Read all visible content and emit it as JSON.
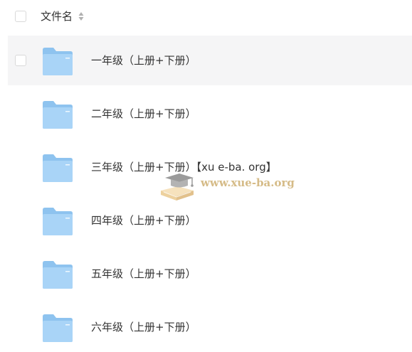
{
  "header": {
    "column_label": "文件名"
  },
  "files": [
    {
      "name": "一年级（上册+下册）",
      "type": "folder",
      "hovered": true
    },
    {
      "name": "二年级（上册+下册）",
      "type": "folder",
      "hovered": false
    },
    {
      "name": "三年级（上册+下册）【xu e-ba. org】",
      "type": "folder",
      "hovered": false
    },
    {
      "name": "四年级（上册+下册）",
      "type": "folder",
      "hovered": false
    },
    {
      "name": "五年级（上册+下册）",
      "type": "folder",
      "hovered": false
    },
    {
      "name": "六年级（上册+下册）",
      "type": "folder",
      "hovered": false
    }
  ],
  "watermark": {
    "text": "www.xue-ba.org",
    "icon": "graduation-cap-book-icon"
  },
  "colors": {
    "hover_row": "#f5f5f6",
    "folder_back": "#8ec3ef",
    "folder_front": "#a9d4f7",
    "watermark": "#c8a560"
  }
}
